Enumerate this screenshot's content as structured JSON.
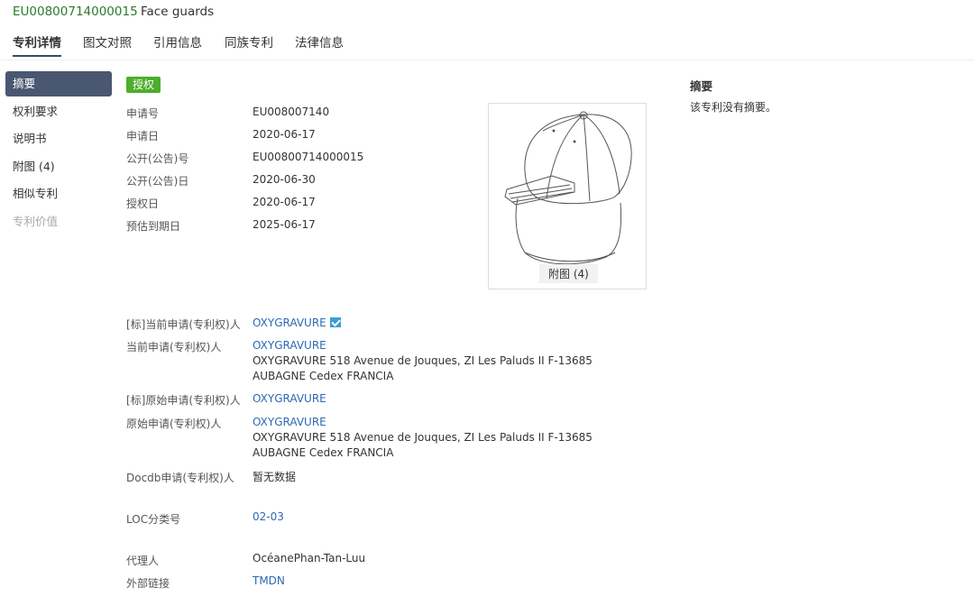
{
  "header": {
    "patent_number": "EU00800714000015",
    "title": "Face guards"
  },
  "tabs": [
    "专利详情",
    "图文对照",
    "引用信息",
    "同族专利",
    "法律信息"
  ],
  "sidebar": {
    "items": [
      "摘要",
      "权利要求",
      "说明书",
      "附图 (4)",
      "相似专利",
      "专利价值"
    ]
  },
  "status_badge": "授权",
  "fields": {
    "application_no": {
      "label": "申请号",
      "value": "EU008007140"
    },
    "application_date": {
      "label": "申请日",
      "value": "2020-06-17"
    },
    "publication_no": {
      "label": "公开(公告)号",
      "value": "EU00800714000015"
    },
    "publication_date": {
      "label": "公开(公告)日",
      "value": "2020-06-30"
    },
    "grant_date": {
      "label": "授权日",
      "value": "2020-06-17"
    },
    "expiry_date": {
      "label": "预估到期日",
      "value": "2025-06-17"
    },
    "std_current_applicant": {
      "label": "[标]当前申请(专利权)人",
      "value": "OXYGRAVURE"
    },
    "current_applicant": {
      "label": "当前申请(专利权)人",
      "name": "OXYGRAVURE",
      "address": "OXYGRAVURE 518 Avenue de Jouques, ZI Les Paluds II F-13685 AUBAGNE Cedex FRANCIA"
    },
    "std_original_applicant": {
      "label": "[标]原始申请(专利权)人",
      "value": "OXYGRAVURE"
    },
    "original_applicant": {
      "label": "原始申请(专利权)人",
      "name": "OXYGRAVURE",
      "address": "OXYGRAVURE 518 Avenue de Jouques, ZI Les Paluds II F-13685 AUBAGNE Cedex FRANCIA"
    },
    "docdb_applicant": {
      "label": "Docdb申请(专利权)人",
      "value": "暂无数据"
    },
    "loc_class": {
      "label": "LOC分类号",
      "value": "02-03"
    },
    "agent": {
      "label": "代理人",
      "value": "OcéanePhan-Tan-Luu"
    },
    "external_link": {
      "label": "外部链接",
      "value": "TMDN"
    }
  },
  "figure": {
    "caption": "附图 (4)"
  },
  "abstract": {
    "title": "摘要",
    "text": "该专利没有摘要。"
  }
}
